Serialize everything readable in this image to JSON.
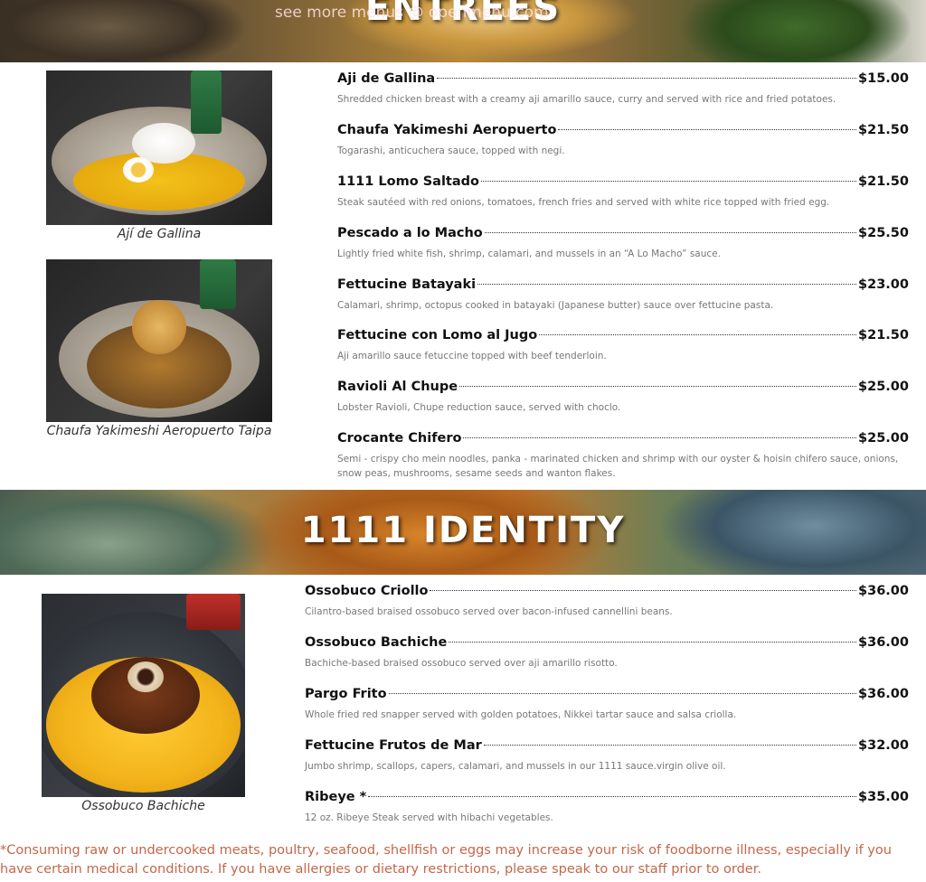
{
  "watermark": "see more menus @ openmenu.com",
  "entrees": {
    "title": "ENTREES",
    "photos": [
      {
        "caption": "Ají de Gallina"
      },
      {
        "caption": "Chaufa Yakimeshi Aeropuerto Taipa"
      }
    ],
    "items": [
      {
        "name": "Aji de Gallina",
        "price": "$15.00",
        "desc": "Shredded chicken breast with a creamy aji amarillo sauce, curry and served with rice and fried potatoes."
      },
      {
        "name": "Chaufa Yakimeshi Aeropuerto",
        "price": "$21.50",
        "desc": "Togarashi, anticuchera sauce, topped with negi."
      },
      {
        "name": "1111 Lomo Saltado",
        "price": "$21.50",
        "desc": "Steak sautéed with red onions, tomatoes, french fries and served with white rice topped with fried egg."
      },
      {
        "name": "Pescado a lo Macho",
        "price": "$25.50",
        "desc": "Lightly fried white fish, shrimp, calamari, and mussels in an “A Lo Macho” sauce."
      },
      {
        "name": "Fettucine Batayaki",
        "price": "$23.00",
        "desc": "Calamari, shrimp, octopus cooked in batayaki (Japanese butter) sauce over fettucine pasta."
      },
      {
        "name": "Fettucine con Lomo al Jugo",
        "price": "$21.50",
        "desc": "Aji amarillo sauce fetuccine topped with beef tenderloin."
      },
      {
        "name": "Ravioli Al Chupe",
        "price": "$25.00",
        "desc": "Lobster Ravioli, Chupe reduction sauce, served with choclo."
      },
      {
        "name": "Crocante Chifero",
        "price": "$25.00",
        "desc": "Semi - crispy cho mein noodles, panka - marinated chicken and shrimp with our oyster & hoisin chifero sauce, onions, snow peas, mushrooms, sesame seeds and wanton flakes."
      }
    ]
  },
  "identity": {
    "title": "1111 IDENTITY",
    "photos": [
      {
        "caption": "Ossobuco Bachiche"
      }
    ],
    "items": [
      {
        "name": "Ossobuco Criollo",
        "price": "$36.00",
        "desc": "Cilantro-based braised ossobuco served over bacon-infused cannellini beans."
      },
      {
        "name": "Ossobuco Bachiche",
        "price": "$36.00",
        "desc": "Bachiche-based braised ossobuco served over aji amarillo risotto."
      },
      {
        "name": "Pargo Frito",
        "price": "$36.00",
        "desc": "Whole fried red snapper served with golden potatoes, Nikkei tartar sauce and salsa criolla."
      },
      {
        "name": "Fettucine Frutos de Mar",
        "price": "$32.00",
        "desc": "Jumbo shrimp, scallops, capers, calamari, and mussels in our 1111 sauce.virgin olive oil."
      },
      {
        "name": "Ribeye *",
        "price": "$35.00",
        "desc": "12 oz. Ribeye Steak served with hibachi vegetables."
      }
    ]
  },
  "footnote": "*Consuming raw or undercooked meats, poultry, seafood, shellfish or eggs may increase your risk of foodborne illness, especially if you have certain medical conditions. If you have allergies or dietary restrictions, please speak to our staff prior to order."
}
